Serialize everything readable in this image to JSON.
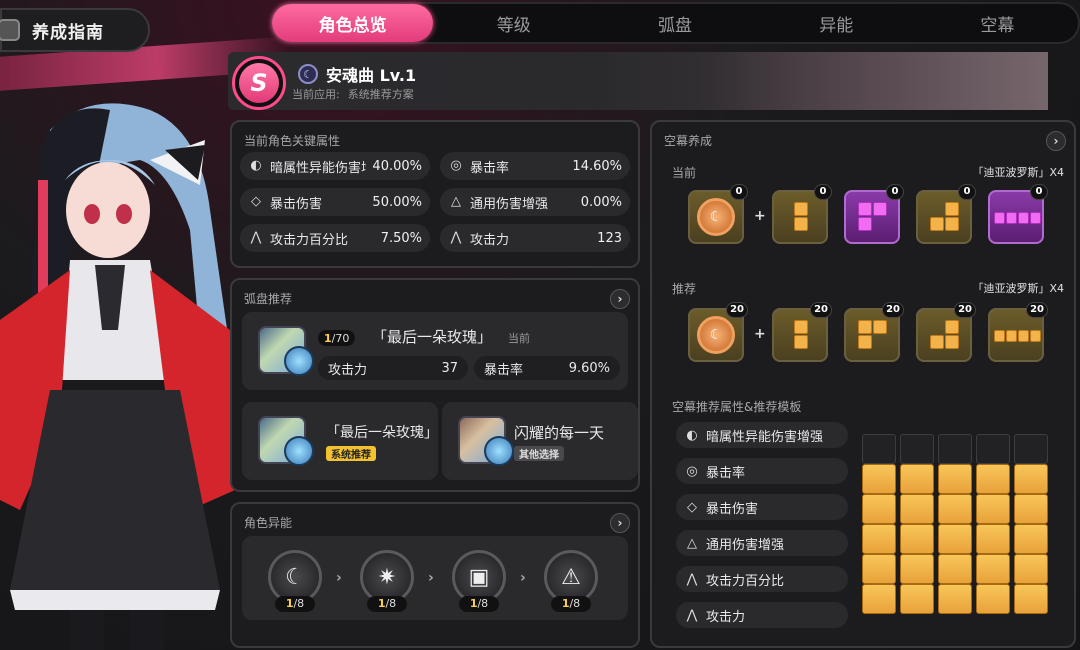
{
  "header": {
    "title": "养成指南",
    "tabs": [
      {
        "label": "角色总览",
        "active": true
      },
      {
        "label": "等级",
        "active": false
      },
      {
        "label": "弧盘",
        "active": false
      },
      {
        "label": "异能",
        "active": false
      },
      {
        "label": "空幕",
        "active": false
      }
    ]
  },
  "build": {
    "rank": "S",
    "name": "安魂曲 Lv.1",
    "applied_label": "当前应用:",
    "applied_value": "系统推荐方案"
  },
  "key_attributes": {
    "title": "当前角色关键属性",
    "items": [
      {
        "icon": "dark-damage-icon",
        "name": "暗属性异能伤害增强",
        "value": "40.00%"
      },
      {
        "icon": "crit-rate-icon",
        "name": "暴击率",
        "value": "14.60%"
      },
      {
        "icon": "crit-damage-icon",
        "name": "暴击伤害",
        "value": "50.00%"
      },
      {
        "icon": "general-damage-icon",
        "name": "通用伤害增强",
        "value": "0.00%"
      },
      {
        "icon": "attack-percent-icon",
        "name": "攻击力百分比",
        "value": "7.50%"
      },
      {
        "icon": "attack-icon",
        "name": "攻击力",
        "value": "123"
      }
    ]
  },
  "arc_disc": {
    "title": "弧盘推荐",
    "current": {
      "level_current": "1",
      "level_max": "/70",
      "name": "「最后一朵玫瑰」",
      "tag": "当前",
      "stats": [
        {
          "name": "攻击力",
          "value": "37"
        },
        {
          "name": "暴击率",
          "value": "9.60%"
        }
      ]
    },
    "options": [
      {
        "name": "「最后一朵玫瑰」",
        "tag": "系统推荐"
      },
      {
        "name": "闪耀的每一天",
        "tag": "其他选择"
      }
    ]
  },
  "skills": {
    "title": "角色异能",
    "items": [
      {
        "icon": "crescent-skill-icon",
        "level_current": "1",
        "level_max": "/8"
      },
      {
        "icon": "burst-skill-icon",
        "level_current": "1",
        "level_max": "/8"
      },
      {
        "icon": "vehicle-skill-icon",
        "level_current": "1",
        "level_max": "/8"
      },
      {
        "icon": "warning-skill-icon",
        "level_current": "1",
        "level_max": "/8"
      }
    ]
  },
  "curtain": {
    "title": "空幕养成",
    "current_label": "当前",
    "current_set": "「迪亚波罗斯」X4",
    "current_counts": [
      "0",
      "0",
      "0",
      "0",
      "0"
    ],
    "recommended_label": "推荐",
    "recommended_set": "「迪亚波罗斯」X4",
    "recommended_counts": [
      "20",
      "20",
      "20",
      "20",
      "20"
    ],
    "template_title": "空幕推荐属性&推荐模板",
    "template_attrs": [
      {
        "icon": "dark-damage-icon",
        "name": "暗属性异能伤害增强"
      },
      {
        "icon": "crit-rate-icon",
        "name": "暴击率"
      },
      {
        "icon": "crit-damage-icon",
        "name": "暴击伤害"
      },
      {
        "icon": "general-damage-icon",
        "name": "通用伤害增强"
      },
      {
        "icon": "attack-percent-icon",
        "name": "攻击力百分比"
      },
      {
        "icon": "attack-icon",
        "name": "攻击力"
      }
    ]
  },
  "colors": {
    "accent": "#e23c7c",
    "gold": "#f4b24a",
    "purple": "#f06cf0"
  }
}
